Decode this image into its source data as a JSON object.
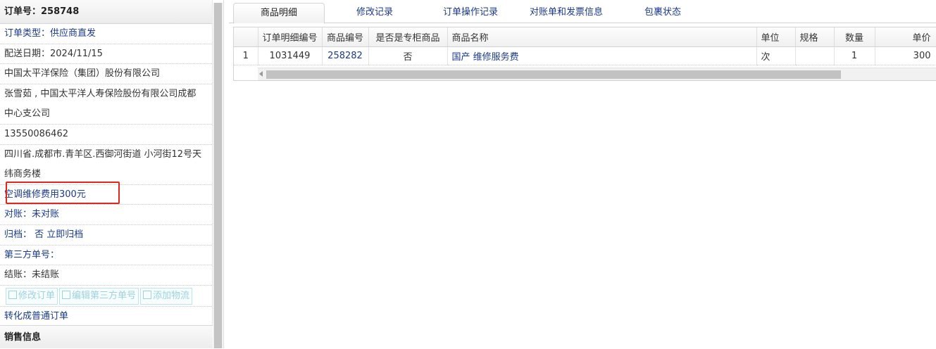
{
  "order": {
    "title": "订单号：258748",
    "type": "订单类型：供应商直发",
    "delivery_date": "配送日期：2024/11/15",
    "company": "中国太平洋保险（集团）股份有限公司",
    "contact_line1": "张雪茹 , 中国太平洋人寿保险股份有限公司成都",
    "contact_line2": "中心支公司",
    "phone": "13550086462",
    "address_line1": "四川省.成都市.青羊区.西御河街道 小河街12号天",
    "address_line2": "纬商务楼",
    "remark": "空调维修费用300元",
    "reconcile": "对账：未对账",
    "archive_label": "归档：",
    "archive_value": "否 立即归档",
    "third_party_no": "第三方单号：",
    "settlement": "结账：未结账",
    "buttons": {
      "modify": "修改订单",
      "edit_third": "编辑第三方单号",
      "add_logistics": "添加物流"
    },
    "convert_link": "转化成普通订单",
    "sales_header": "销售信息"
  },
  "tabs": [
    "商品明细",
    "修改记录",
    "订单操作记录",
    "对账单和发票信息",
    "包裹状态"
  ],
  "table": {
    "headers": [
      "",
      "订单明细编号",
      "商品编号",
      "是否是专柜商品",
      "商品名称",
      "单位",
      "规格",
      "数量",
      "单价"
    ],
    "rows": [
      [
        "1",
        "1031449",
        "258282",
        "否",
        "国产 维修服务费",
        "次",
        "",
        "1",
        "300"
      ]
    ]
  },
  "colors": {
    "link": "#1a3a8c",
    "highlight": "#e0261f"
  }
}
